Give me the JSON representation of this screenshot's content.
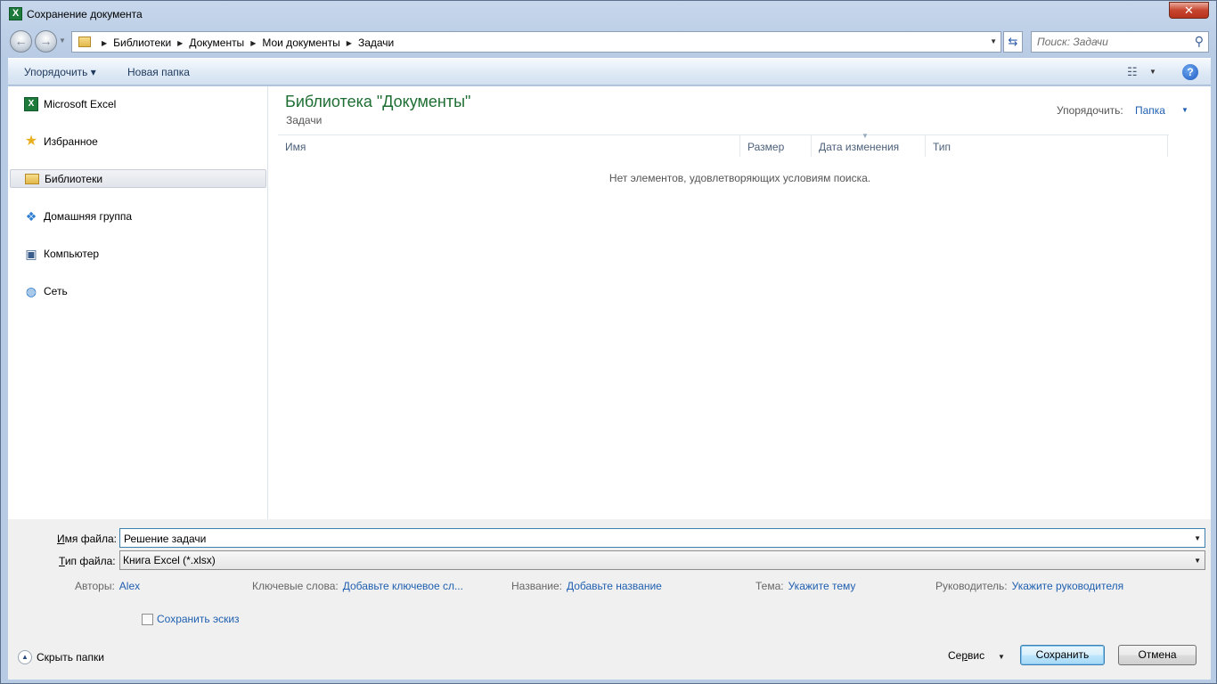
{
  "window": {
    "title": "Сохранение документа",
    "close_label": "✕"
  },
  "nav": {
    "breadcrumbs": [
      "Библиотеки",
      "Документы",
      "Мои документы",
      "Задачи"
    ],
    "search_placeholder": "Поиск: Задачи"
  },
  "toolbar": {
    "organize_label": "Упорядочить ▾",
    "new_folder_label": "Новая папка"
  },
  "sidebar": {
    "items": [
      {
        "label": "Microsoft Excel",
        "icon": "excel-icon"
      },
      {
        "label": "Избранное",
        "icon": "star-icon"
      },
      {
        "label": "Библиотеки",
        "icon": "libraries-icon",
        "selected": true
      },
      {
        "label": "Домашняя группа",
        "icon": "homegroup-icon"
      },
      {
        "label": "Компьютер",
        "icon": "computer-icon"
      },
      {
        "label": "Сеть",
        "icon": "network-icon"
      }
    ]
  },
  "main": {
    "library_title": "Библиотека \"Документы\"",
    "library_subtitle": "Задачи",
    "arrange_label": "Упорядочить:",
    "arrange_value": "Папка",
    "columns": [
      "Имя",
      "Размер",
      "Дата изменения",
      "Тип"
    ],
    "empty_message": "Нет элементов, удовлетворяющих условиям поиска."
  },
  "form": {
    "filename_label_u": "И",
    "filename_label_rest": "мя файла:",
    "filename_value": "Решение задачи",
    "filetype_label_u": "Т",
    "filetype_label_rest": "ип файла:",
    "filetype_value": "Книга Excel (*.xlsx)"
  },
  "meta": {
    "authors_label": "Авторы:",
    "authors_value": "Alex",
    "keywords_label": "Ключевые слова:",
    "keywords_value": "Добавьте ключевое сл...",
    "title_label": "Название:",
    "title_value": "Добавьте название",
    "theme_label": "Тема:",
    "theme_value": "Укажите тему",
    "manager_label": "Руководитель:",
    "manager_value": "Укажите руководителя"
  },
  "footer": {
    "thumbnail_label": "Сохранить эскиз",
    "hide_folders_label": "Скрыть папки",
    "service_label_pre": "Се",
    "service_label_u": "р",
    "service_label_post": "вис",
    "save_label": "Сохранить",
    "cancel_label": "Отмена"
  }
}
